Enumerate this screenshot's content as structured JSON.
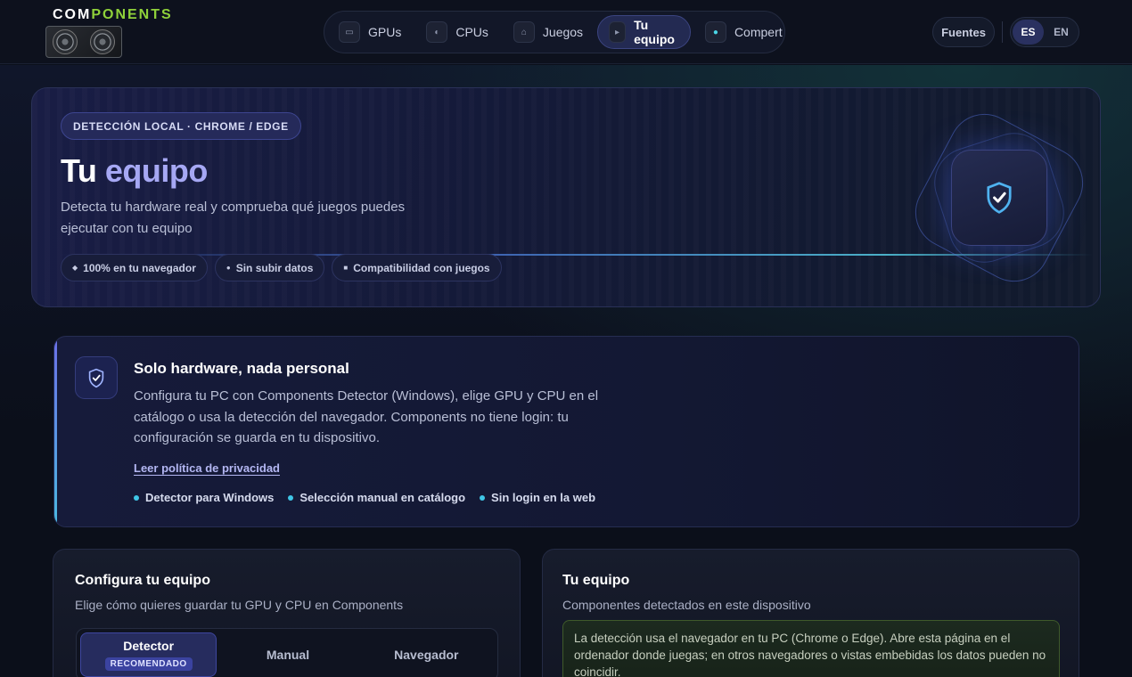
{
  "brand": {
    "logo_main": "COM",
    "logo_accent": "PONENTS"
  },
  "nav": {
    "items": [
      {
        "label": "GPUs",
        "icon": "gpu-icon"
      },
      {
        "label": "CPUs",
        "icon": "cpu-icon"
      },
      {
        "label": "Juegos",
        "icon": "gamepad-icon"
      },
      {
        "label": "Tu equipo",
        "icon": "play-icon",
        "active": true
      },
      {
        "label": "Compert",
        "icon": "dots-icon"
      }
    ]
  },
  "header_actions": {
    "sources_label": "Fuentes",
    "lang_es": "ES",
    "lang_en": "EN",
    "lang_selected": "ES"
  },
  "hero": {
    "badge": "DETECCIÓN LOCAL · CHROME / EDGE",
    "title_main": "Tu",
    "title_accent": "equipo",
    "subtitle": "Detecta tu hardware real y comprueba qué juegos puedes ejecutar con tu equipo",
    "chips": [
      "100% en tu navegador",
      "Sin subir datos",
      "Compatibilidad con juegos"
    ]
  },
  "privacy": {
    "title": "Solo hardware, nada personal",
    "body": "Configura tu PC con Components Detector (Windows), elige GPU y CPU en el catálogo o usa la detección del navegador. Components no tiene login: tu configuración se guarda en tu dispositivo.",
    "link": "Leer política de privacidad",
    "bullets": [
      "Detector para Windows",
      "Selección manual en catálogo",
      "Sin login en la web"
    ]
  },
  "configure_card": {
    "title": "Configura tu equipo",
    "subtitle": "Elige cómo quieres guardar tu GPU y CPU en Components",
    "tabs": [
      {
        "label": "Detector",
        "badge": "RECOMENDADO",
        "active": true
      },
      {
        "label": "Manual"
      },
      {
        "label": "Navegador"
      }
    ]
  },
  "equipment_card": {
    "title": "Tu equipo",
    "subtitle": "Componentes detectados en este dispositivo",
    "notice": "La detección usa el navegador en tu PC (Chrome o Edge). Abre esta página en el ordenador donde juegas; en otros navegadores o vistas embebidas los datos pueden no coincidir."
  },
  "colors": {
    "accent": "#a6a8f4",
    "brand_green": "#8fd13a",
    "cyan": "#3fc6e6",
    "background": "#0b0f1a"
  }
}
